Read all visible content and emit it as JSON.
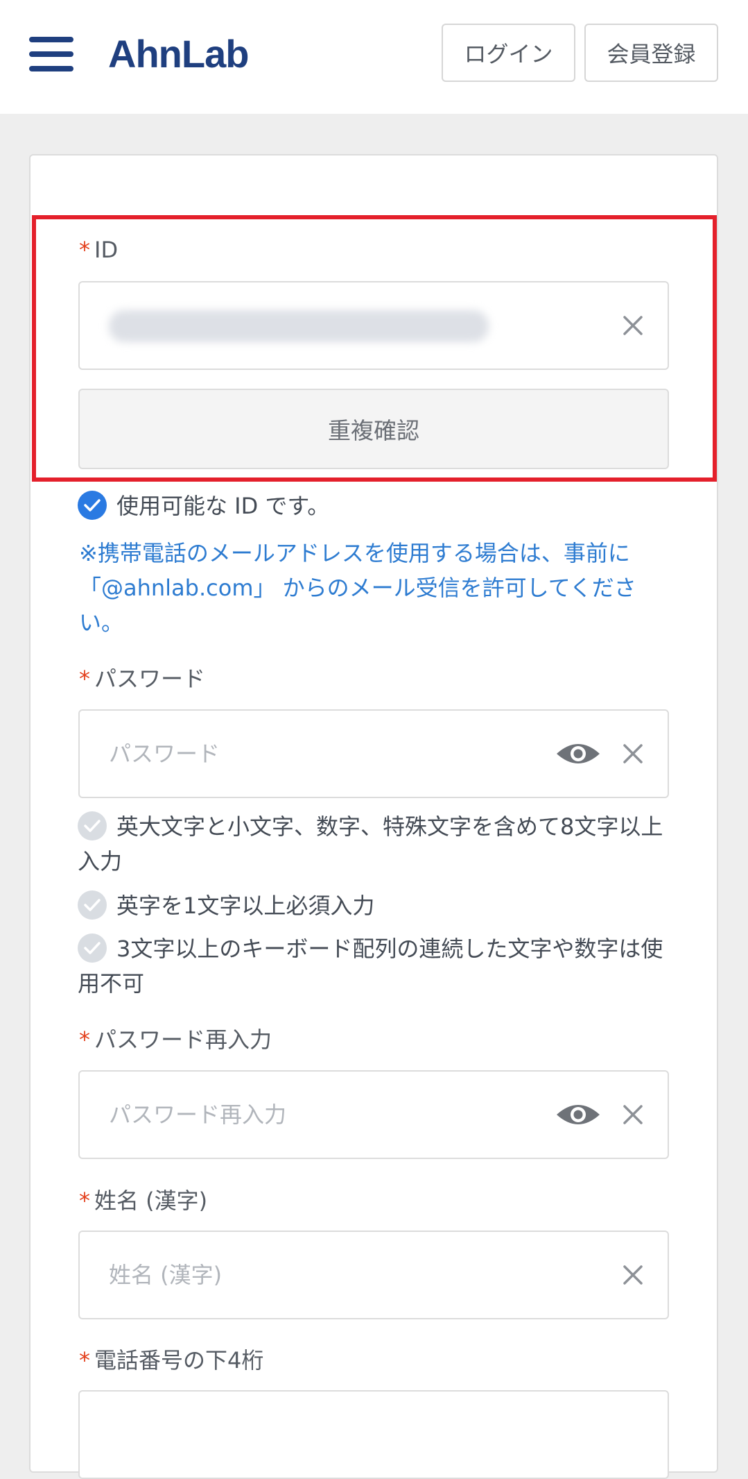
{
  "header": {
    "logo": "AhnLab",
    "login_label": "ログイン",
    "signup_label": "会員登録"
  },
  "form": {
    "required_mark": "*",
    "id": {
      "label": "ID",
      "duplicate_check_label": "重複確認",
      "available_message": "使用可能な ID です。"
    },
    "notice": "※携帯電話のメールアドレスを使用する場合は、事前に 「@ahnlab.com」 からのメール受信を許可してください。",
    "password": {
      "label": "パスワード",
      "placeholder": "パスワード",
      "rules": [
        "英大文字と小文字、数字、特殊文字を含めて8文字以上入力",
        "英字を1文字以上必須入力",
        "3文字以上のキーボード配列の連続した文字や数字は使用不可"
      ]
    },
    "password_confirm": {
      "label": "パスワード再入力",
      "placeholder": "パスワード再入力"
    },
    "name": {
      "label": "姓名 (漢字)",
      "placeholder": "姓名 (漢字)"
    },
    "phone": {
      "label": "電話番号の下4桁"
    }
  },
  "colors": {
    "brand": "#1f3f7f",
    "required": "#e3401d",
    "link_blue": "#2e7cd1",
    "check_on": "#2a7ae2",
    "check_off": "#d9dde2",
    "highlight": "#e4202b"
  }
}
